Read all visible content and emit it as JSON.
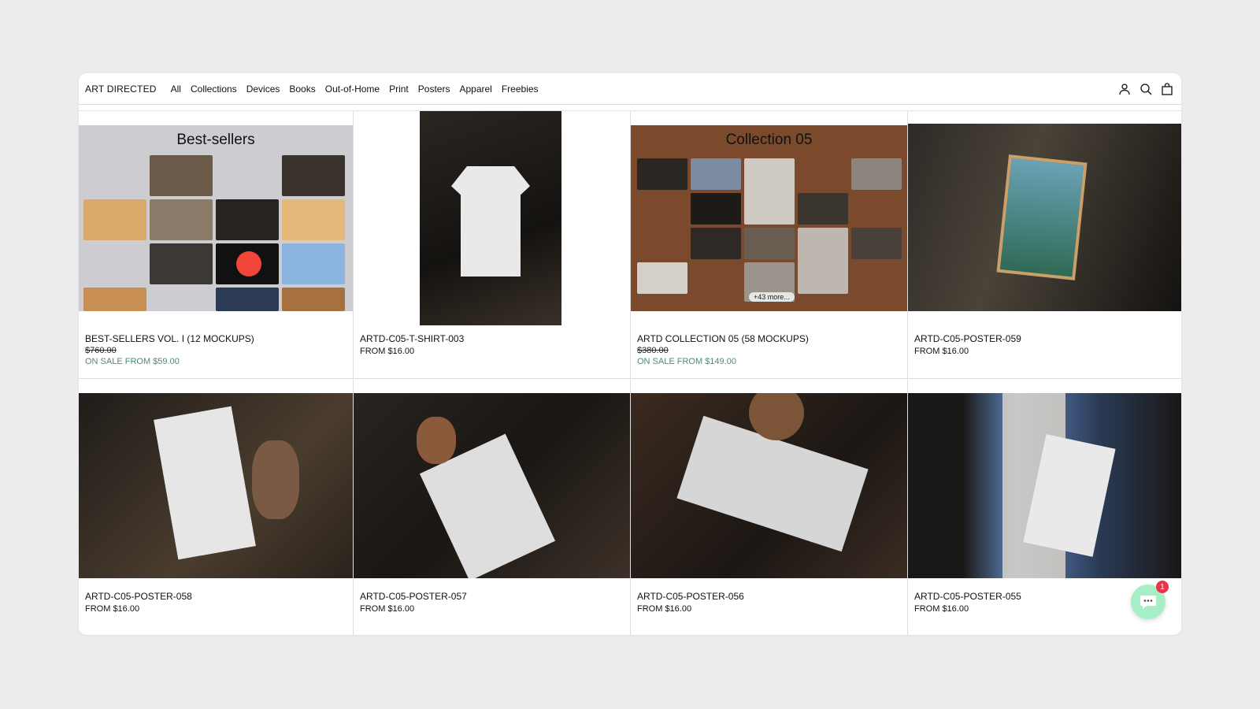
{
  "brand": "ART DIRECTED",
  "nav": {
    "items": [
      {
        "label": "All"
      },
      {
        "label": "Collections"
      },
      {
        "label": "Devices"
      },
      {
        "label": "Books"
      },
      {
        "label": "Out-of-Home"
      },
      {
        "label": "Print"
      },
      {
        "label": "Posters"
      },
      {
        "label": "Apparel"
      },
      {
        "label": "Freebies"
      }
    ],
    "icons": [
      "account-icon",
      "search-icon",
      "cart-icon"
    ]
  },
  "products": [
    {
      "title": "BEST-SELLERS VOL. I (12 MOCKUPS)",
      "compare_price": "$760.00",
      "sale_price": "ON SALE FROM $59.00",
      "image_heading": "Best-sellers"
    },
    {
      "title": "ARTD-C05-T-SHIRT-003",
      "price": "FROM $16.00"
    },
    {
      "title": "ARTD COLLECTION 05 (58 MOCKUPS)",
      "compare_price": "$380.00",
      "sale_price": "ON SALE FROM $149.00",
      "image_heading": "Collection 05",
      "image_chip": "+43 more..."
    },
    {
      "title": "ARTD-C05-POSTER-059",
      "price": "FROM $16.00"
    },
    {
      "title": "ARTD-C05-POSTER-058",
      "price": "FROM $16.00"
    },
    {
      "title": "ARTD-C05-POSTER-057",
      "price": "FROM $16.00"
    },
    {
      "title": "ARTD-C05-POSTER-056",
      "price": "FROM $16.00"
    },
    {
      "title": "ARTD-C05-POSTER-055",
      "price": "FROM $16.00"
    }
  ],
  "chat": {
    "badge": "1"
  },
  "colors": {
    "sale": "#4f8a6e",
    "collection_bg": "#7b4a2c",
    "chat_bg": "#a6eec5",
    "badge": "#e8334a"
  }
}
